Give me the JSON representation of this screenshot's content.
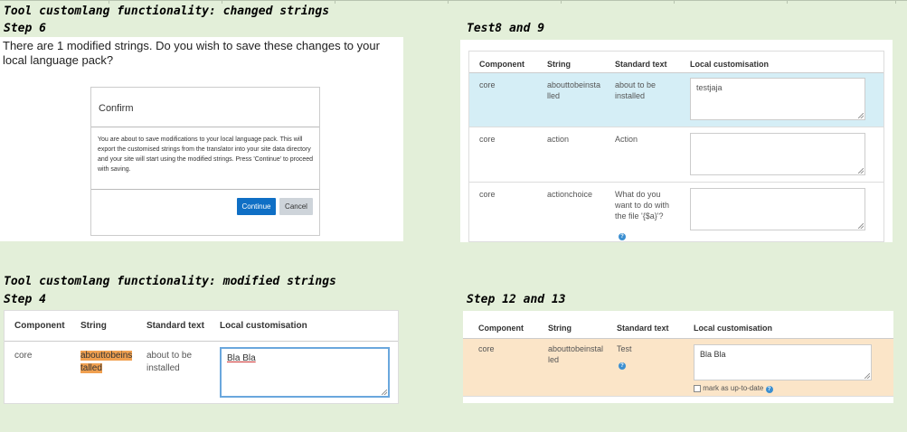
{
  "headings": {
    "changed": "Tool customlang functionality: changed strings",
    "step6": "Step 6",
    "test8": "Test8 and 9",
    "modified": "Tool customlang functionality: modified strings",
    "step4": "Step 4",
    "step12": "Step 12 and 13"
  },
  "step6": {
    "question": "There are 1 modified strings. Do you wish to save these changes to your local language pack?",
    "dialog_title": "Confirm",
    "dialog_body": "You are about to save modifications to your local language pack. This will export the customised strings from the translator into your site data directory and your site will start using the modified strings. Press 'Continue' to proceed with saving.",
    "continue_label": "Continue",
    "cancel_label": "Cancel",
    "accent": "#0f6fc5"
  },
  "test8": {
    "columns": [
      "Component",
      "String",
      "Standard text",
      "Local customisation"
    ],
    "rows": [
      {
        "component": "core",
        "string": "abouttobeinstalled",
        "standard": "about to be installed",
        "custom": "testjaja"
      },
      {
        "component": "core",
        "string": "action",
        "standard": "Action",
        "custom": ""
      },
      {
        "component": "core",
        "string": "actionchoice",
        "standard": "What do you want to do with the file '{$a}'?",
        "custom": ""
      }
    ],
    "highlight": "#d5eef6"
  },
  "step4": {
    "columns": [
      "Component",
      "String",
      "Standard text",
      "Local customisation"
    ],
    "row": {
      "component": "core",
      "string": "abouttobeinstalled",
      "standard": "about to be installed",
      "custom": "Bla Bla"
    },
    "string_highlight": "#f0a050"
  },
  "step12": {
    "columns": [
      "Component",
      "String",
      "Standard text",
      "Local customisation"
    ],
    "row": {
      "component": "core",
      "string": "abouttobeinstalled",
      "standard": "Test",
      "custom": "Bla Bla",
      "checkbox_label": "mark as up-to-date"
    },
    "highlight": "#fbe5c8"
  }
}
